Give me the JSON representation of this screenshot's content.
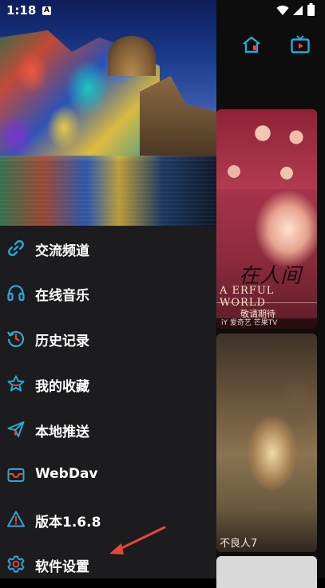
{
  "status_bar": {
    "time": "1:18",
    "notification_badge": "A"
  },
  "background": {
    "poster1": {
      "calligraphy": "在人间",
      "english": "A   ERFUL WORLD",
      "tagline": "敬请期待",
      "bottom_text": "iY 爱奇艺   芒果TV"
    },
    "poster2": {
      "title": "不良人7"
    }
  },
  "drawer": {
    "items": [
      {
        "label": "交流频道",
        "icon": "link-icon"
      },
      {
        "label": "在线音乐",
        "icon": "headphones-icon"
      },
      {
        "label": "历史记录",
        "icon": "history-icon"
      },
      {
        "label": "我的收藏",
        "icon": "star-icon"
      },
      {
        "label": "本地推送",
        "icon": "send-icon"
      },
      {
        "label": "WebDav",
        "icon": "inbox-icon"
      },
      {
        "label": "版本1.6.8",
        "icon": "warning-icon"
      },
      {
        "label": "软件设置",
        "icon": "gear-icon"
      }
    ]
  },
  "colors": {
    "accent": "#29a8d8",
    "drawer_bg": "#1c1c1e",
    "arrow": "#e4473a"
  }
}
